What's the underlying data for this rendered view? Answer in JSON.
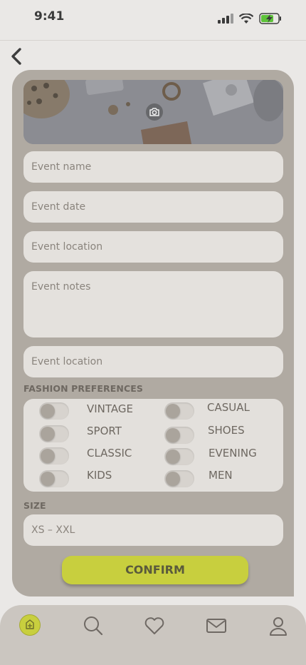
{
  "status": {
    "time": "9:41"
  },
  "form": {
    "event_name_placeholder": "Event name",
    "event_date_placeholder": "Event date",
    "event_location_placeholder": "Event location",
    "event_notes_placeholder": "Event notes",
    "event_location2_placeholder": "Event location"
  },
  "fashion": {
    "title": "FASHION PREFERENCES",
    "options": [
      {
        "label": "VINTAGE",
        "on": false
      },
      {
        "label": "CASUAL",
        "on": false
      },
      {
        "label": "SPORT",
        "on": false
      },
      {
        "label": "SHOES",
        "on": false
      },
      {
        "label": "CLASSIC",
        "on": false
      },
      {
        "label": "EVENING",
        "on": false
      },
      {
        "label": "KIDS",
        "on": false
      },
      {
        "label": "MEN",
        "on": false
      }
    ]
  },
  "size": {
    "title": "SIZE",
    "placeholder": "XS – XXL"
  },
  "actions": {
    "confirm_label": "CONFIRM"
  },
  "colors": {
    "accent": "#c8cf3e",
    "card": "#b0aaa2",
    "field": "#e4e1dd"
  },
  "nav": {
    "items": [
      "home-icon",
      "search-icon",
      "heart-icon",
      "mail-icon",
      "profile-icon"
    ]
  }
}
